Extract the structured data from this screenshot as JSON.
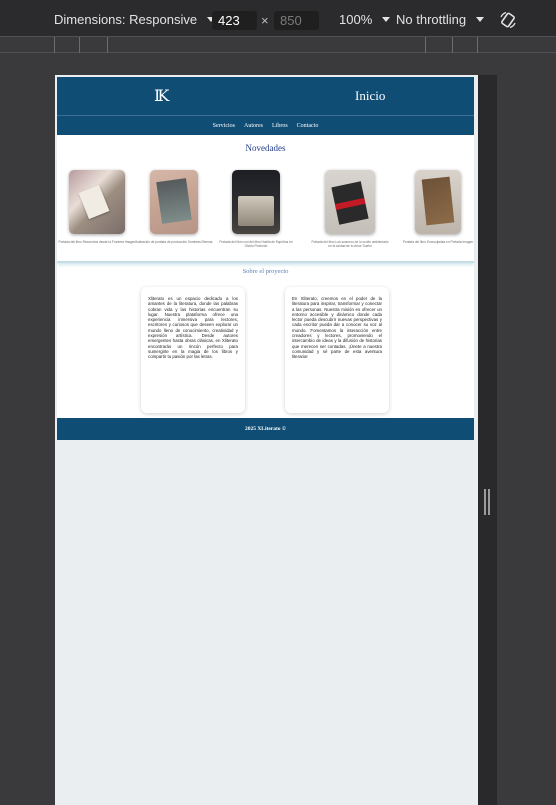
{
  "devtools": {
    "dimensions_label": "Dimensions: Responsive",
    "width_value": "423",
    "height_placeholder": "850",
    "times_symbol": "×",
    "zoom": "100%",
    "throttling": "No throttling"
  },
  "site": {
    "logo": "IK",
    "header_title": "Inicio",
    "nav": [
      "Servicios",
      "Autores",
      "Libros",
      "Contacto"
    ],
    "news_title": "Novedades",
    "books": [
      {
        "caption": "Portada del libro Recuerdos desde la Frontera Imagen"
      },
      {
        "caption": "Ilustración de portada de producción Sombras Eternas"
      },
      {
        "caption": "Portada del libro con del libro Huella de Espíritus en Olvido Profundo"
      },
      {
        "caption": "Portada del libro Los susurros de lo oculto ambientado en la ciudad de tu Amor Sueño"
      },
      {
        "caption": "Portada del libro Encrucijadas en Portada Imagen"
      }
    ],
    "about_title": "Sobre el proyecto",
    "about_left": "Xliterato es un espacio dedicado a los amantes de la literatura, donde las palabras cobran vida y las historias encuentran su lugar. Nuestra plataforma ofrece una experiencia inmersiva para lectores, escritores y curiosos que deseen explorar un mundo lleno de conocimiento, creatividad y expresión artística. Desde autores emergentes hasta obras clásicas, en Xliterato encontrarás un rincón perfecto para sumergirte en la magia de los libros y compartir tu pasión por las letras.",
    "about_right": "En Xliterato, creemos en el poder de la literatura para inspirar, transformar y conectar a las personas. Nuestra misión es ofrecer un entorno accesible y dinámico donde cada lector pueda descubrir nuevas perspectivas y cada escritor pueda dar a conocer su voz al mundo. Fomentamos la interacción entre creadores y lectores, promoviendo el intercambio de ideas y la difusión de historias que merecen ser contadas. ¡Únete a nuestra comunidad y sé parte de esta aventura literaria!",
    "footer": "2025 XLiterato ©"
  },
  "colors": {
    "brand": "#0f4d75",
    "section_title": "#203b8a"
  }
}
